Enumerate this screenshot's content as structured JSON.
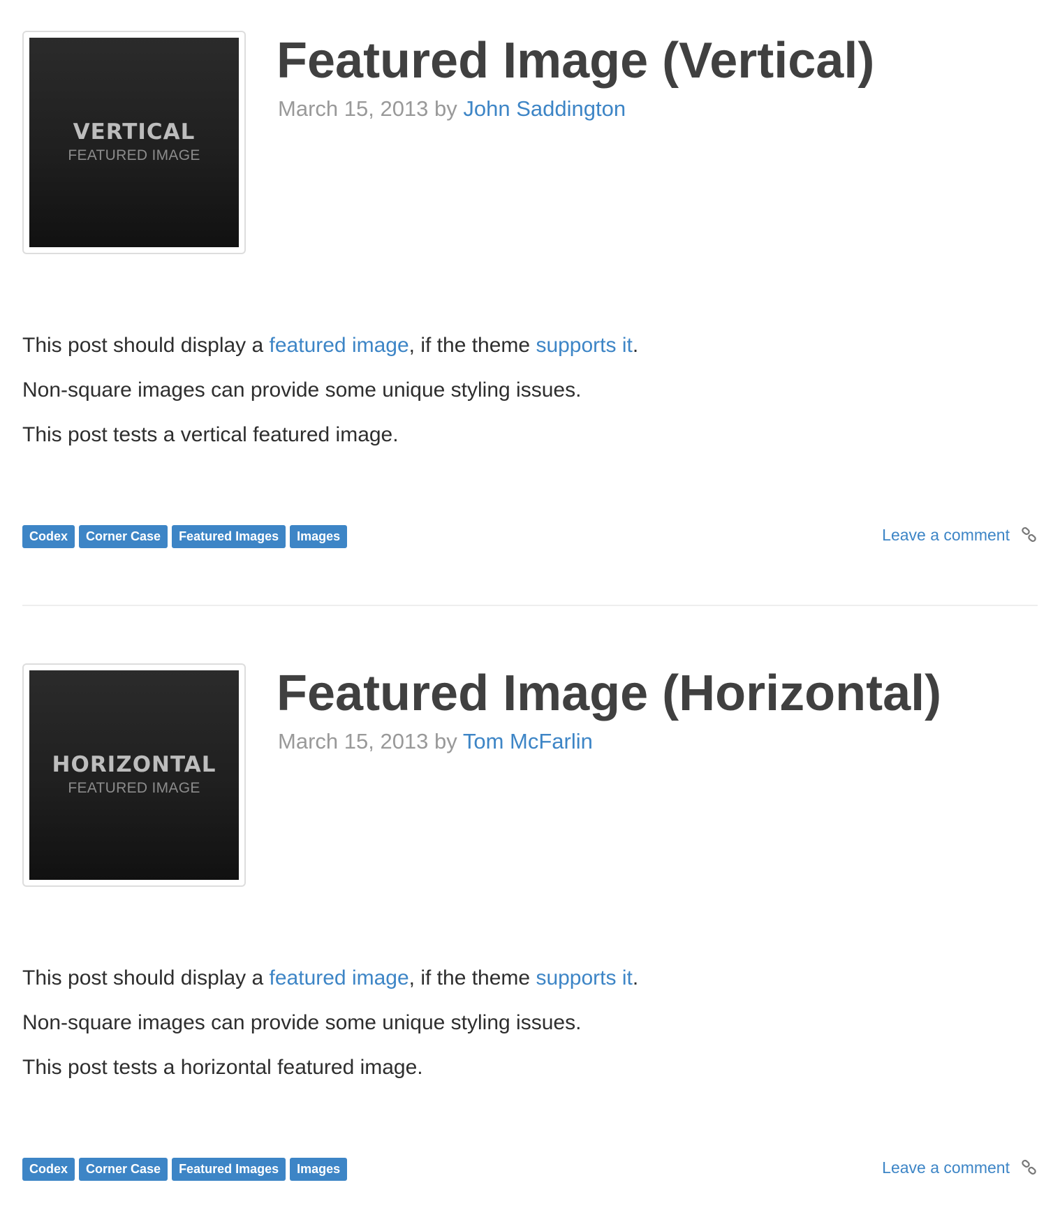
{
  "posts": [
    {
      "thumbnail": {
        "big_text": "VERTICAL",
        "small_text": "FEATURED IMAGE"
      },
      "title": "Featured Image (Vertical)",
      "date": "March 15, 2013",
      "by": "by",
      "author": "John Saddington",
      "body": {
        "p1_prefix": "This post should display a ",
        "p1_link1": "featured image",
        "p1_middle": ", if the theme ",
        "p1_link2": "supports it",
        "p1_suffix": ".",
        "p2": "Non-square images can provide some unique styling issues.",
        "p3": "This post tests a vertical featured image."
      },
      "tags": [
        "Codex",
        "Corner Case",
        "Featured Images",
        "Images"
      ],
      "comment_label": "Leave a comment"
    },
    {
      "thumbnail": {
        "big_text": "HORIZONTAL",
        "small_text": "FEATURED IMAGE"
      },
      "title": "Featured Image (Horizontal)",
      "date": "March 15, 2013",
      "by": "by",
      "author": "Tom McFarlin",
      "body": {
        "p1_prefix": "This post should display a ",
        "p1_link1": "featured image",
        "p1_middle": ", if the theme ",
        "p1_link2": "supports it",
        "p1_suffix": ".",
        "p2": "Non-square images can provide some unique styling issues.",
        "p3": "This post tests a horizontal featured image."
      },
      "tags": [
        "Codex",
        "Corner Case",
        "Featured Images",
        "Images"
      ],
      "comment_label": "Leave a comment"
    }
  ],
  "colors": {
    "link": "#3d85c6",
    "tag_bg": "#3d85c6",
    "title": "#404040",
    "meta": "#999999",
    "divider": "#eeeeee"
  },
  "icons": {
    "permalink": "link-icon"
  }
}
